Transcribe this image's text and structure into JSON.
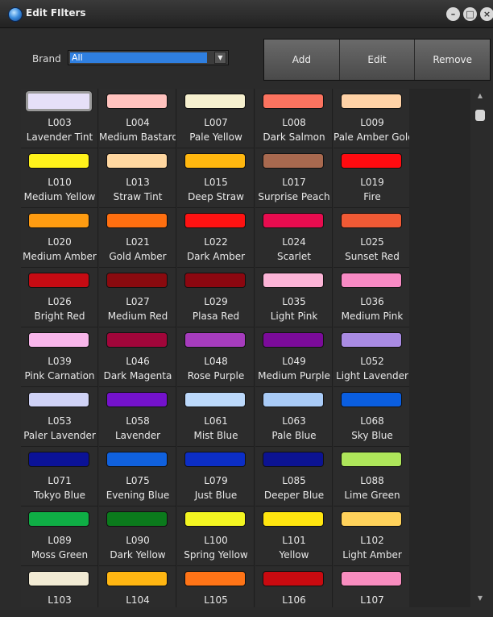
{
  "window": {
    "title": "Edit FIlters"
  },
  "brand": {
    "label": "Brand",
    "value": "All"
  },
  "buttons": {
    "add": "Add",
    "edit": "Edit",
    "remove": "Remove"
  },
  "filters": [
    {
      "code": "L003",
      "name": "Lavender Tint",
      "color": "#e6e0f8",
      "selected": true
    },
    {
      "code": "L004",
      "name": "Medium Bastard Amber",
      "color": "#ffc2be"
    },
    {
      "code": "L007",
      "name": "Pale Yellow",
      "color": "#f6f0cf"
    },
    {
      "code": "L008",
      "name": "Dark Salmon",
      "color": "#fb735f"
    },
    {
      "code": "L009",
      "name": "Pale Amber Gold",
      "color": "#ffd2a6"
    },
    {
      "code": "L010",
      "name": "Medium Yellow",
      "color": "#fff21b"
    },
    {
      "code": "L013",
      "name": "Straw Tint",
      "color": "#ffd7a0"
    },
    {
      "code": "L015",
      "name": "Deep Straw",
      "color": "#ffb70f"
    },
    {
      "code": "L017",
      "name": "Surprise Peach",
      "color": "#a8694f"
    },
    {
      "code": "L019",
      "name": "Fire",
      "color": "#ff0b10"
    },
    {
      "code": "L020",
      "name": "Medium Amber",
      "color": "#ff9c11"
    },
    {
      "code": "L021",
      "name": "Gold Amber",
      "color": "#ff6f10"
    },
    {
      "code": "L022",
      "name": "Dark Amber",
      "color": "#ff1212"
    },
    {
      "code": "L024",
      "name": "Scarlet",
      "color": "#e80c4f"
    },
    {
      "code": "L025",
      "name": "Sunset Red",
      "color": "#f15a35"
    },
    {
      "code": "L026",
      "name": "Bright Red",
      "color": "#c60b13"
    },
    {
      "code": "L027",
      "name": "Medium Red",
      "color": "#8a0a0f"
    },
    {
      "code": "L029",
      "name": "Plasa Red",
      "color": "#8c0710"
    },
    {
      "code": "L035",
      "name": "Light Pink",
      "color": "#fcb4d7"
    },
    {
      "code": "L036",
      "name": "Medium Pink",
      "color": "#f88ac4"
    },
    {
      "code": "L039",
      "name": "Pink Carnation",
      "color": "#f8b6ea"
    },
    {
      "code": "L046",
      "name": "Dark Magenta",
      "color": "#a1063a"
    },
    {
      "code": "L048",
      "name": "Rose Purple",
      "color": "#a63cbd"
    },
    {
      "code": "L049",
      "name": "Medium Purple",
      "color": "#7b0b9a"
    },
    {
      "code": "L052",
      "name": "Light Lavender",
      "color": "#a98be3"
    },
    {
      "code": "L053",
      "name": "Paler Lavender",
      "color": "#cfd2f6"
    },
    {
      "code": "L058",
      "name": "Lavender",
      "color": "#7412cc"
    },
    {
      "code": "L061",
      "name": "Mist Blue",
      "color": "#bcd9fb"
    },
    {
      "code": "L063",
      "name": "Pale Blue",
      "color": "#a9cbf7"
    },
    {
      "code": "L068",
      "name": "Sky Blue",
      "color": "#0a5ee0"
    },
    {
      "code": "L071",
      "name": "Tokyo Blue",
      "color": "#0b1297"
    },
    {
      "code": "L075",
      "name": "Evening Blue",
      "color": "#1061de"
    },
    {
      "code": "L079",
      "name": "Just Blue",
      "color": "#0c2ec6"
    },
    {
      "code": "L085",
      "name": "Deeper Blue",
      "color": "#0c1392"
    },
    {
      "code": "L088",
      "name": "Lime Green",
      "color": "#aee65a"
    },
    {
      "code": "L089",
      "name": "Moss Green",
      "color": "#0fae45"
    },
    {
      "code": "L090",
      "name": "Dark Yellow",
      "color": "#0b7a1c"
    },
    {
      "code": "L100",
      "name": "Spring Yellow",
      "color": "#f3f521"
    },
    {
      "code": "L101",
      "name": "Yellow",
      "color": "#ffe50f"
    },
    {
      "code": "L102",
      "name": "Light Amber",
      "color": "#ffd25b"
    },
    {
      "code": "L103",
      "name": "",
      "color": "#f2ebd4"
    },
    {
      "code": "L104",
      "name": "",
      "color": "#ffb612"
    },
    {
      "code": "L105",
      "name": "",
      "color": "#ff7417"
    },
    {
      "code": "L106",
      "name": "",
      "color": "#c90a10"
    },
    {
      "code": "L107",
      "name": "",
      "color": "#f88dbf"
    }
  ]
}
